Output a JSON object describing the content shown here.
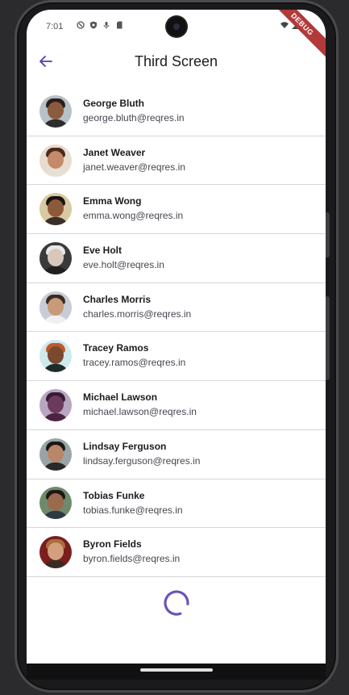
{
  "status_bar": {
    "time": "7:01",
    "left_icons": [
      "notification-shield-icon",
      "vpn-shield-icon",
      "mic-icon",
      "sd-card-icon"
    ],
    "right_icons": [
      "wifi-icon",
      "signal-icon",
      "battery-icon"
    ]
  },
  "debug_banner": "DEBUG",
  "app_bar": {
    "title": "Third Screen",
    "back_icon": "arrow-back-icon",
    "accent": "#4e3fb5"
  },
  "users": [
    {
      "name": "George Bluth",
      "email": "george.bluth@reqres.in",
      "bg": "#b7c1c8",
      "skin": "#8a5b3e",
      "hair": "#2a1f1a",
      "shirt": "#2e2e2e"
    },
    {
      "name": "Janet Weaver",
      "email": "janet.weaver@reqres.in",
      "bg": "#e9dccf",
      "skin": "#c48a6a",
      "hair": "#4a2b1c",
      "shirt": "#e7e0d6"
    },
    {
      "name": "Emma Wong",
      "email": "emma.wong@reqres.in",
      "bg": "#d9c9a3",
      "skin": "#8c5a3a",
      "hair": "#1a1410",
      "shirt": "#3a2f28"
    },
    {
      "name": "Eve Holt",
      "email": "eve.holt@reqres.in",
      "bg": "#3a3a3a",
      "skin": "#d8c8bc",
      "hair": "#e8e8e8",
      "shirt": "#1f1f1f"
    },
    {
      "name": "Charles Morris",
      "email": "charles.morris@reqres.in",
      "bg": "#c8ccd6",
      "skin": "#c79a7a",
      "hair": "#3b2a20",
      "shirt": "#f0f0f0"
    },
    {
      "name": "Tracey Ramos",
      "email": "tracey.ramos@reqres.in",
      "bg": "#cfe9ec",
      "skin": "#7a4a30",
      "hair": "#c0582c",
      "shirt": "#1d2c2a"
    },
    {
      "name": "Michael Lawson",
      "email": "michael.lawson@reqres.in",
      "bg": "#b9a6c2",
      "skin": "#6b3b5e",
      "hair": "#3a1a35",
      "shirt": "#4a2440"
    },
    {
      "name": "Lindsay Ferguson",
      "email": "lindsay.ferguson@reqres.in",
      "bg": "#9aa4a8",
      "skin": "#b8876a",
      "hair": "#1c1816",
      "shirt": "#2a2a2a"
    },
    {
      "name": "Tobias Funke",
      "email": "tobias.funke@reqres.in",
      "bg": "#6f8a6a",
      "skin": "#9a6a4e",
      "hair": "#1e1814",
      "shirt": "#2d3a44"
    },
    {
      "name": "Byron Fields",
      "email": "byron.fields@reqres.in",
      "bg": "#7a1e1e",
      "skin": "#d2a07e",
      "hair": "#a8703e",
      "shirt": "#3a2a24"
    }
  ],
  "loading_indicator": {
    "icon": "circular-progress-icon",
    "color": "#6a52b8"
  }
}
